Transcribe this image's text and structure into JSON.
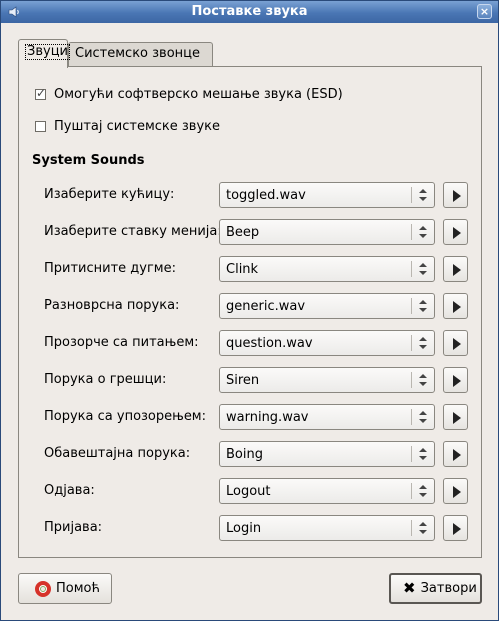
{
  "window": {
    "title": "Поставке звука",
    "close_glyph": "×"
  },
  "tabs": [
    {
      "label": "Звуци",
      "active": true
    },
    {
      "label": "Системско звонце",
      "active": false
    }
  ],
  "options": {
    "esd": {
      "label": "Омогући софтверско мешање звука (ESD)",
      "checked": true
    },
    "system_sounds": {
      "label": "Пуштај системске звуке",
      "checked": false
    }
  },
  "section": {
    "title": "System Sounds"
  },
  "sounds": [
    {
      "label": "Изаберите кућицу:",
      "value": "toggled.wav"
    },
    {
      "label": "Изаберите ставку менија:",
      "value": "Beep"
    },
    {
      "label": "Притисните дугме:",
      "value": "Clink"
    },
    {
      "label": "Разноврсна порука:",
      "value": "generic.wav"
    },
    {
      "label": "Прозорче са питањем:",
      "value": "question.wav"
    },
    {
      "label": "Порука о грешци:",
      "value": "Siren"
    },
    {
      "label": "Порука са упозорењем:",
      "value": "warning.wav"
    },
    {
      "label": "Обавештајна порука:",
      "value": "Boing"
    },
    {
      "label": "Одјава:",
      "value": "Logout"
    },
    {
      "label": "Пријава:",
      "value": "Login"
    }
  ],
  "buttons": {
    "help": "Помоћ",
    "close": "Затвори"
  },
  "icons": {
    "app": "speaker-icon",
    "help": "lifebuoy-icon",
    "close": "x-icon",
    "play": "play-icon"
  },
  "colors": {
    "titlebar": "#4a76b4",
    "window_bg": "#efebe7",
    "lifebuoy": "#d6332a"
  }
}
